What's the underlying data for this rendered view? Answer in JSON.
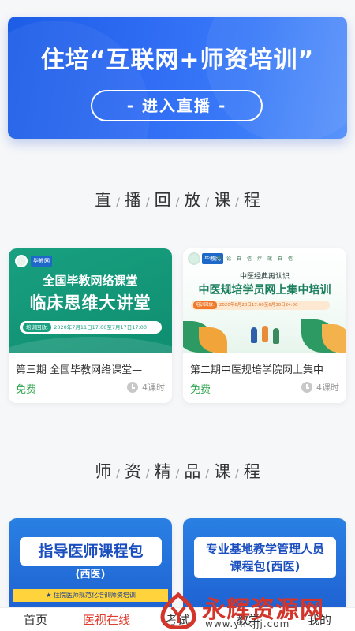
{
  "hero": {
    "title": "住培“互联网+师资培训”",
    "button": "- 进入直播 -"
  },
  "sections": {
    "replay": [
      "直",
      "播",
      "回",
      "放",
      "课",
      "程"
    ],
    "teacher": [
      "师",
      "资",
      "精",
      "品",
      "课",
      "程"
    ]
  },
  "replay_courses": [
    {
      "title": "第三期 全国毕教网络课堂—",
      "price": "免费",
      "hours": "4课时",
      "thumb": {
        "tag": "毕教网",
        "line1": "全国毕教网络课堂",
        "line2": "临床思维大讲堂",
        "pill_lead": "培训回放:",
        "pill_text": "2020年7月11日17:00至7月17日17:00"
      }
    },
    {
      "title": "第二期中医规培学院网上集中",
      "price": "免费",
      "hours": "4课时",
      "thumb": {
        "tag": "毕教网",
        "motto": "理论自信疗效自信",
        "sub": "中医经典再认识",
        "main": "中医规培学员网上集中培训",
        "pill_lead": "培训回放:",
        "pill_text": "2020年6月20日17:00至6月30日24:00"
      }
    }
  ],
  "teacher_courses": [
    {
      "label": "指导医师课程包",
      "sub": "(西医)",
      "strip": "★ 住院医师规范化培训师资培训"
    },
    {
      "label_line1": "专业基地教学管理人员",
      "label_line2": "课程包(西医)"
    }
  ],
  "bottom_nav": [
    {
      "label": "首页",
      "active": false
    },
    {
      "label": "医视在线",
      "active": true
    },
    {
      "label": "考试",
      "active": false
    },
    {
      "label": "教学",
      "active": false
    },
    {
      "label": "我的",
      "active": false
    }
  ],
  "watermark": {
    "text": "永辉资源网",
    "url": "www.yhkjjj.com"
  },
  "colors": {
    "hero_blue": "#2f6cf4",
    "free_green": "#2ca44c",
    "active_red": "#e03d2f"
  }
}
